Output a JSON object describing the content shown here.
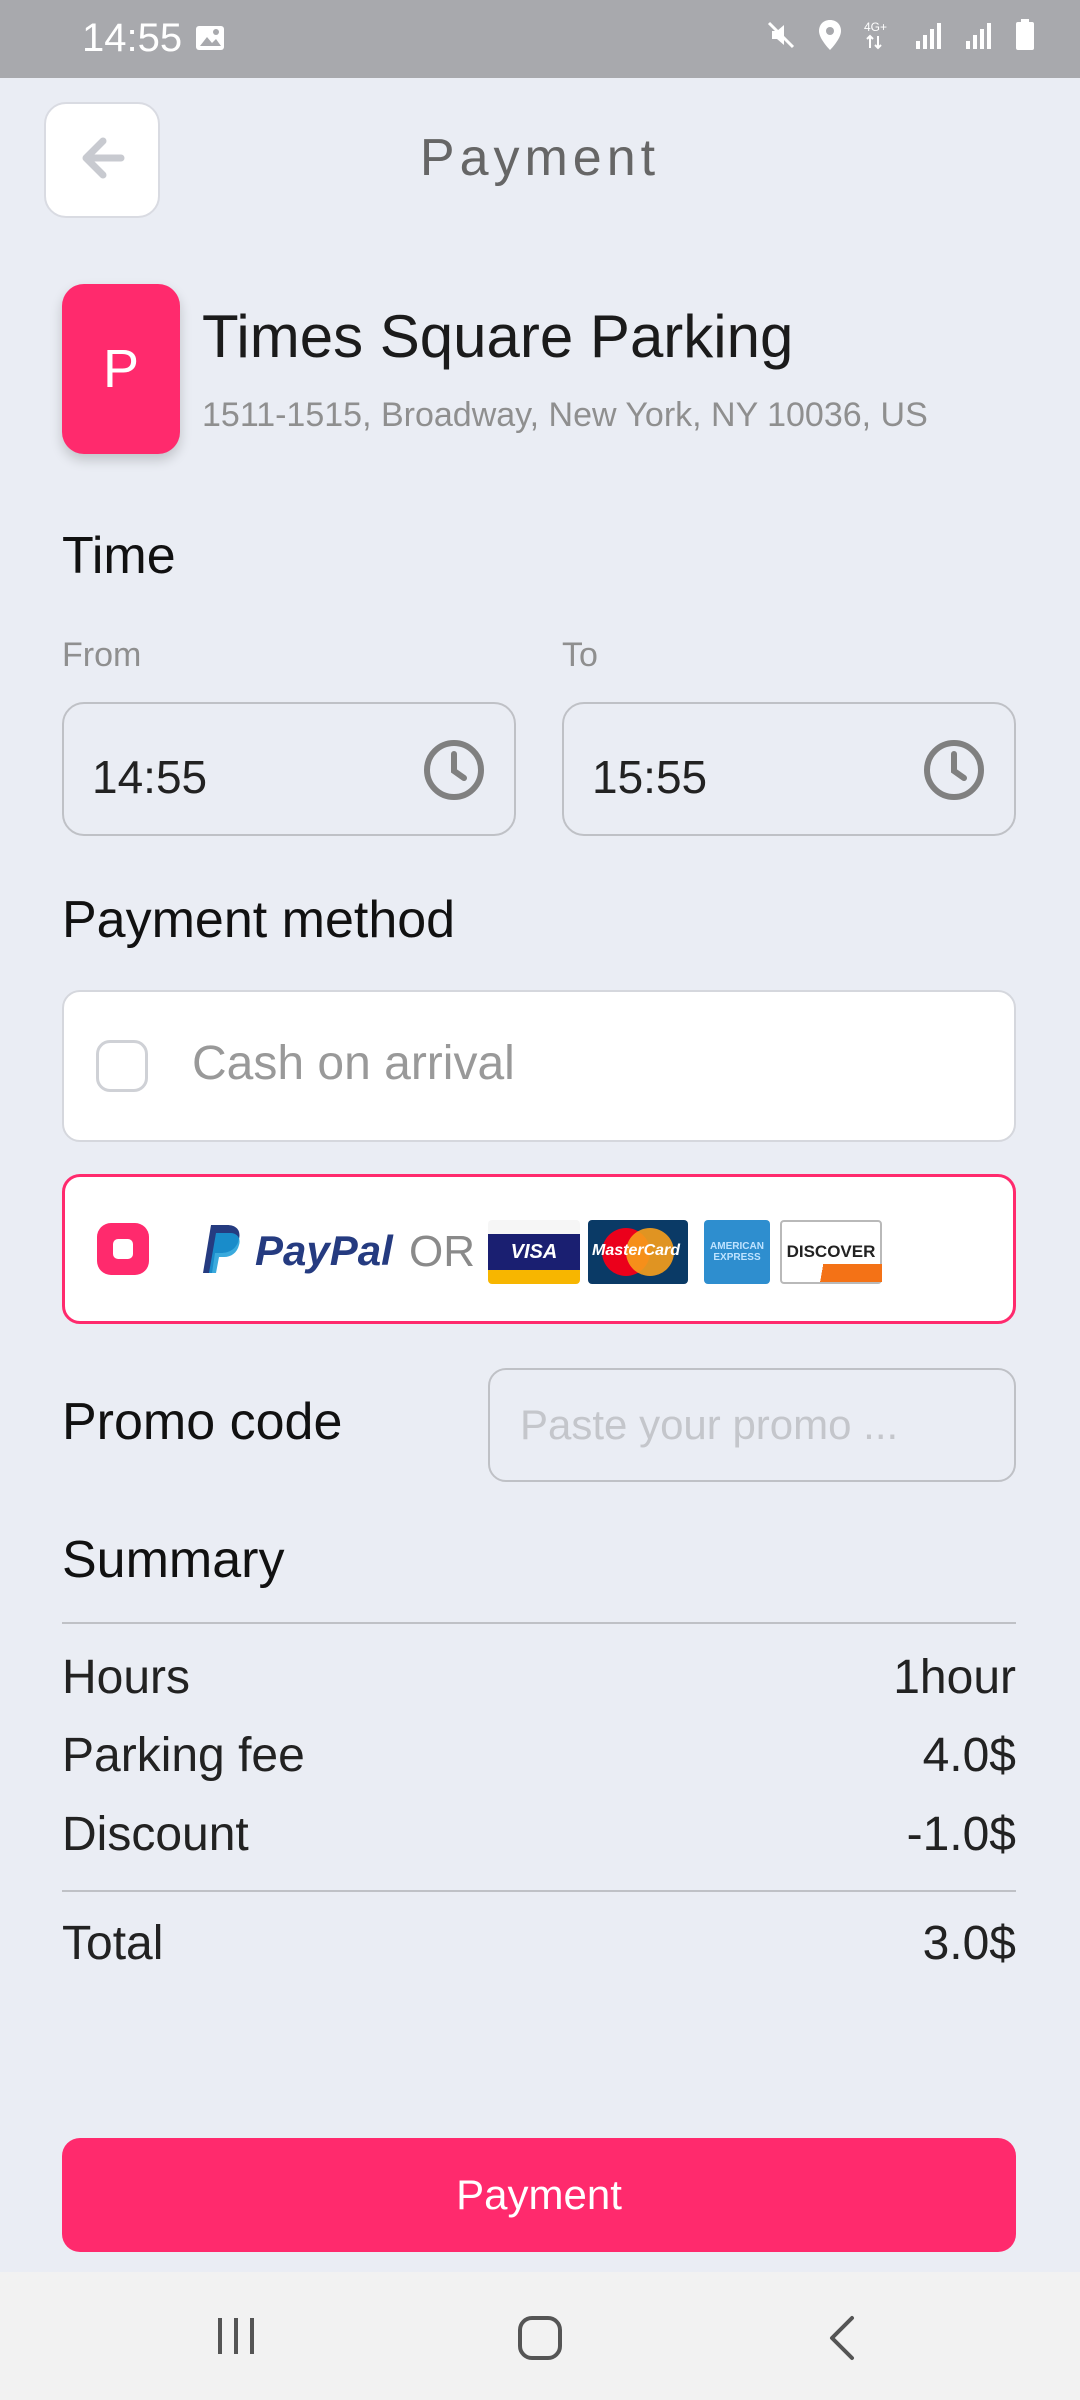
{
  "status_bar": {
    "time": "14:55"
  },
  "header": {
    "title": "Payment"
  },
  "parking": {
    "logo_letter": "P",
    "name": "Times Square Parking",
    "address": "1511-1515, Broadway, New York, NY 10036, US"
  },
  "time": {
    "section_title": "Time",
    "from_label": "From",
    "from_value": "14:55",
    "to_label": "To",
    "to_value": "15:55"
  },
  "payment_method": {
    "section_title": "Payment method",
    "cash_label": "Cash on arrival",
    "paypal_label": "PayPal",
    "or_label": "OR",
    "cards": [
      "VISA",
      "MasterCard",
      "AMERICAN EXPRESS",
      "DISCOVER"
    ],
    "selected": "paypal"
  },
  "promo": {
    "label": "Promo code",
    "placeholder": "Paste your promo ..."
  },
  "summary": {
    "section_title": "Summary",
    "rows": [
      {
        "label": "Hours",
        "value": "1hour"
      },
      {
        "label": "Parking fee",
        "value": "4.0$"
      },
      {
        "label": "Discount",
        "value": "-1.0$"
      }
    ],
    "total_label": "Total",
    "total_value": "3.0$"
  },
  "action": {
    "pay_label": "Payment"
  },
  "colors": {
    "accent": "#ff2a6d",
    "background": "#eaedf4"
  }
}
